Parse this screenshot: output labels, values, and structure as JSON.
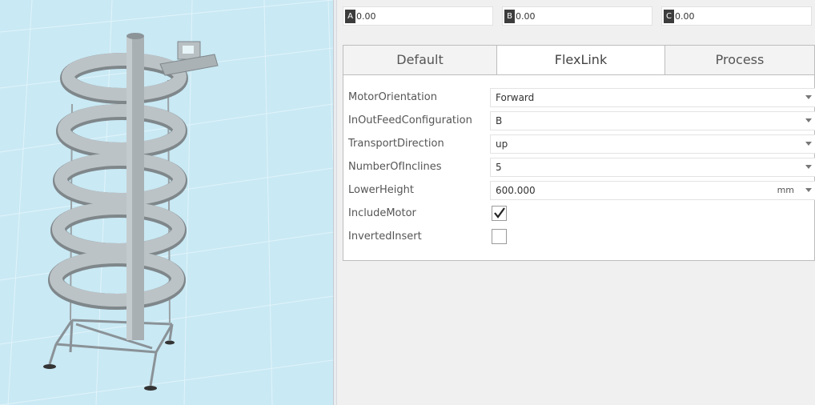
{
  "coordinates": [
    {
      "tag": "A",
      "value": "0.00"
    },
    {
      "tag": "B",
      "value": "0.00"
    },
    {
      "tag": "C",
      "value": "0.00"
    }
  ],
  "tabs": [
    {
      "label": "Default",
      "active": false
    },
    {
      "label": "FlexLink",
      "active": true
    },
    {
      "label": "Process",
      "active": false
    }
  ],
  "properties": [
    {
      "label": "MotorOrientation",
      "type": "combo",
      "value": "Forward"
    },
    {
      "label": "InOutFeedConfiguration",
      "type": "combo",
      "value": "B"
    },
    {
      "label": "TransportDirection",
      "type": "combo",
      "value": "up"
    },
    {
      "label": "NumberOfInclines",
      "type": "combo",
      "value": "5"
    },
    {
      "label": "LowerHeight",
      "type": "combo",
      "value": "600.000",
      "unit": "mm"
    },
    {
      "label": "IncludeMotor",
      "type": "checkbox",
      "checked": true
    },
    {
      "label": "InvertedInsert",
      "type": "checkbox",
      "checked": false
    }
  ],
  "viewport": {
    "background_color": "#c9e9f4",
    "model": "spiral-conveyor-icon"
  }
}
